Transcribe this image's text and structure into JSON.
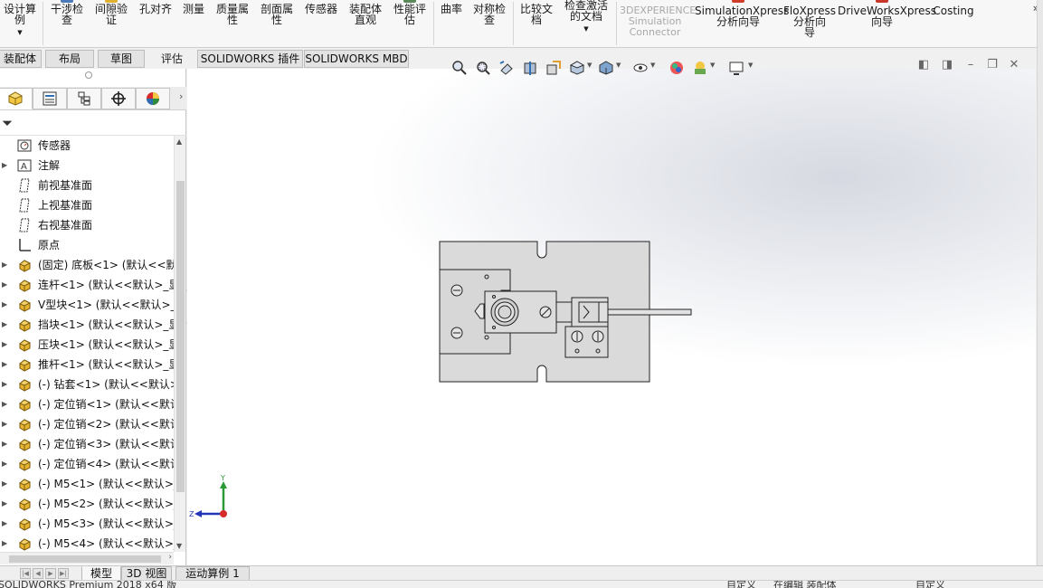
{
  "ribbon": {
    "buttons": [
      {
        "label": "设计算\n例",
        "dropdown": true
      },
      {
        "label": "干涉检\n查"
      },
      {
        "label": "间隙验\n证"
      },
      {
        "label": "孔对齐"
      },
      {
        "label": "测量"
      },
      {
        "label": "质量属\n性"
      },
      {
        "label": "剖面属\n性"
      },
      {
        "label": "传感器"
      },
      {
        "label": "装配体\n直观"
      },
      {
        "label": "性能评\n估"
      },
      {
        "label": "曲率"
      },
      {
        "label": "对称检\n查"
      },
      {
        "label": "比较文\n档"
      },
      {
        "label": "检查激活\n的文档",
        "dropdown": true
      },
      {
        "label": "3DEXPERIENCE\nSimulation\nConnector",
        "disabled": true
      },
      {
        "label": "SimulationXpress\n分析向导"
      },
      {
        "label": "FloXpress\n分析向\n导"
      },
      {
        "label": "DriveWorksXpress\n向导"
      },
      {
        "label": "Costing"
      }
    ],
    "more": "»"
  },
  "tabs": [
    {
      "label": "装配体"
    },
    {
      "label": "布局"
    },
    {
      "label": "草图"
    },
    {
      "label": "评估",
      "active": true
    },
    {
      "label": "SOLIDWORKS 插件"
    },
    {
      "label": "SOLIDWORKS MBD"
    }
  ],
  "panel": {
    "tabs": [
      {
        "icon": "feature-manager-icon"
      },
      {
        "icon": "property-manager-icon"
      },
      {
        "icon": "configuration-manager-icon"
      },
      {
        "icon": "dimxpert-manager-icon"
      },
      {
        "icon": "display-manager-icon"
      }
    ],
    "filter_icon": "filter-icon",
    "tree": [
      {
        "label": "传感器",
        "icon": "sensor-icon",
        "expandable": false
      },
      {
        "label": "注解",
        "icon": "annotation-icon",
        "expandable": true
      },
      {
        "label": "前视基准面",
        "icon": "plane-icon",
        "expandable": false
      },
      {
        "label": "上视基准面",
        "icon": "plane-icon",
        "expandable": false
      },
      {
        "label": "右视基准面",
        "icon": "plane-icon",
        "expandable": false
      },
      {
        "label": "原点",
        "icon": "origin-icon",
        "expandable": false
      },
      {
        "label": "(固定) 底板<1> (默认<<默认",
        "icon": "part-icon",
        "expandable": true
      },
      {
        "label": "连杆<1> (默认<<默认>_显",
        "icon": "part-icon",
        "expandable": true
      },
      {
        "label": "V型块<1> (默认<<默认>_显",
        "icon": "part-icon",
        "expandable": true
      },
      {
        "label": "挡块<1> (默认<<默认>_显",
        "icon": "part-icon",
        "expandable": true
      },
      {
        "label": "压块<1> (默认<<默认>_显",
        "icon": "part-icon",
        "expandable": true
      },
      {
        "label": "推杆<1> (默认<<默认>_显",
        "icon": "part-icon",
        "expandable": true
      },
      {
        "label": "(-) 钻套<1> (默认<<默认>_",
        "icon": "part-icon",
        "expandable": true
      },
      {
        "label": "(-) 定位销<1> (默认<<默认",
        "icon": "part-icon",
        "expandable": true
      },
      {
        "label": "(-) 定位销<2> (默认<<默认",
        "icon": "part-icon",
        "expandable": true
      },
      {
        "label": "(-) 定位销<3> (默认<<默认",
        "icon": "part-icon",
        "expandable": true
      },
      {
        "label": "(-) 定位销<4> (默认<<默认",
        "icon": "part-icon",
        "expandable": true
      },
      {
        "label": "(-) M5<1> (默认<<默认>_",
        "icon": "part-icon",
        "expandable": true
      },
      {
        "label": "(-) M5<2> (默认<<默认>_",
        "icon": "part-icon",
        "expandable": true
      },
      {
        "label": "(-) M5<3> (默认<<默认>_",
        "icon": "part-icon",
        "expandable": true
      },
      {
        "label": "(-) M5<4> (默认<<默认>_",
        "icon": "part-icon",
        "expandable": true
      }
    ]
  },
  "viewport": {
    "toolbar_icons": [
      "zoom-to-fit-icon",
      "zoom-to-area-icon",
      "previous-view-icon",
      "section-view-icon",
      "dynamic-annotation-icon",
      "view-orientation-icon",
      "display-style-icon",
      "hide-show-items-icon",
      "edit-appearance-icon",
      "apply-scene-icon",
      "view-settings-icon"
    ],
    "triad": {
      "x_label": "Z",
      "y_label": "Y"
    }
  },
  "bottom_tabs": [
    {
      "label": "模型",
      "active": true
    },
    {
      "label": "3D 视图"
    },
    {
      "label": "运动算例 1"
    }
  ],
  "status": {
    "app": "SOLIDWORKS Premium 2018 x64 版",
    "custom": "自定义",
    "editing": "在编辑 装配体",
    "units": "自定义"
  },
  "colors": {
    "part_yellow": "#e5b432",
    "accent_blue": "#2e6fb3",
    "drawing_fill": "#dadada"
  }
}
